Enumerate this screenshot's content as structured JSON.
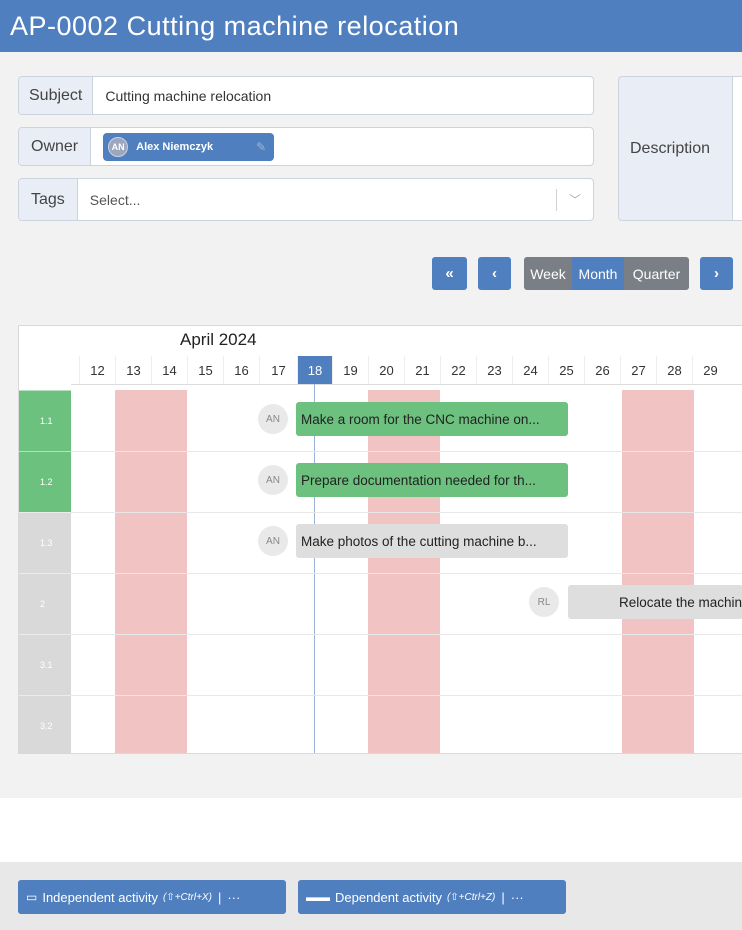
{
  "title": "AP-0002 Cutting machine relocation",
  "form": {
    "subject_label": "Subject",
    "subject_value": "Cutting machine relocation",
    "owner_label": "Owner",
    "owner_initials": "AN",
    "owner_name": "Alex Niemczyk",
    "tags_label": "Tags",
    "tags_placeholder": "Select...",
    "description_label": "Description"
  },
  "nav": {
    "first": "«",
    "prev": "‹",
    "next": "›",
    "views": [
      "Week",
      "Month",
      "Quarter"
    ],
    "active_view": "Month"
  },
  "gantt": {
    "month": "April 2024",
    "days": [
      "12",
      "13",
      "14",
      "15",
      "16",
      "17",
      "18",
      "19",
      "20",
      "21",
      "22",
      "23",
      "24",
      "25",
      "26",
      "27",
      "28",
      "29"
    ],
    "today": "18",
    "rows": [
      {
        "label": "1.1",
        "status": "done"
      },
      {
        "label": "1.2",
        "status": "done"
      },
      {
        "label": "1.3",
        "status": "open"
      },
      {
        "label": "2",
        "status": "open"
      },
      {
        "label": "3.1",
        "status": "open"
      },
      {
        "label": "3.2",
        "status": "open"
      }
    ],
    "tasks": [
      {
        "initials": "AN",
        "text": "Make a room for the CNC machine on...",
        "status": "done"
      },
      {
        "initials": "AN",
        "text": "Prepare documentation needed for th...",
        "status": "done"
      },
      {
        "initials": "AN",
        "text": "Make photos of the cutting machine b...",
        "status": "open"
      },
      {
        "initials": "RL",
        "text": "Relocate the machine",
        "status": "open"
      }
    ]
  },
  "footer": {
    "independent_label": "Independent activity",
    "independent_shortcut": "(⇧+Ctrl+X)",
    "dependent_label": "Dependent activity",
    "dependent_shortcut": "(⇧+Ctrl+Z)",
    "separator": "|",
    "more": "···"
  },
  "colors": {
    "brand": "#4f7fbf",
    "done": "#6cc17f",
    "weekend": "#f2c3c3"
  }
}
